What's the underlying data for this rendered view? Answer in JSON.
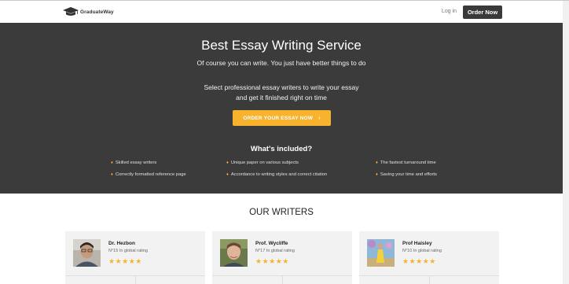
{
  "header": {
    "logo_text": "GraduateWay",
    "login_label": "Log in",
    "order_label": "Order Now"
  },
  "hero": {
    "title": "Best Essay Writing Service",
    "subtitle": "Of course you can write. You just have better things to do",
    "desc_line1": "Select professional essay writers to write your essay",
    "desc_line2": "and get it finished right on time",
    "cta_label": "ORDER YOUR ESSAY NOW",
    "cta_arrow": "›"
  },
  "included": {
    "title": "What's included?",
    "items": [
      "Skilled essay writers",
      "Unique paper on various subjects",
      "The fastest turnaround time",
      "Correctly formatted reference page",
      "Accordance to writing styles and correct citation",
      "Saving your time and efforts"
    ],
    "bullet": "♦"
  },
  "writers": {
    "title": "OUR WRITERS",
    "list": [
      {
        "name": "Dr. Hezbon",
        "rank": "N°15 In global rating",
        "stars": "★★★★★"
      },
      {
        "name": "Prof. Wycliffe",
        "rank": "N°17 In global rating",
        "stars": "★★★★★"
      },
      {
        "name": "Prof Haisley",
        "rank": "N°10 In global rating",
        "stars": "★★★★★"
      }
    ]
  },
  "colors": {
    "hero_bg": "#3b3b3b",
    "accent": "#f7b32d",
    "card_bg": "#f2f2f2"
  }
}
